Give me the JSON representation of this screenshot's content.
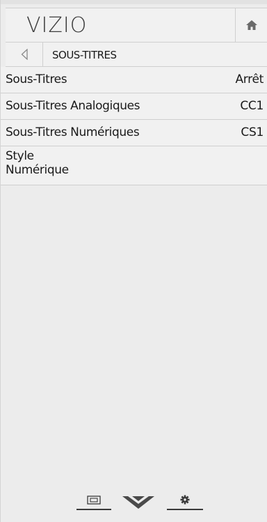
{
  "header": {
    "logo_text": "VIZIO",
    "home_icon": "home-icon"
  },
  "backbar": {
    "back_icon": "back-arrow-icon",
    "title": "SOUS-TITRES"
  },
  "menu": {
    "items": [
      {
        "label": "Sous-Titres",
        "value": "Arrêt"
      },
      {
        "label": "Sous-Titres Analogiques",
        "value": "CC1"
      },
      {
        "label": "Sous-Titres Numériques",
        "value": "CS1"
      },
      {
        "label": "Style\nNumérique",
        "value": ""
      }
    ]
  },
  "bottom_nav": {
    "items": [
      {
        "icon": "input-icon"
      },
      {
        "icon": "vizio-v-icon"
      },
      {
        "icon": "settings-gear-icon"
      }
    ]
  },
  "colors": {
    "panel_bg": "#ececec",
    "row_bg": "#f1f1f1",
    "divider": "#cfcfcf",
    "text": "#1a1a1a"
  }
}
